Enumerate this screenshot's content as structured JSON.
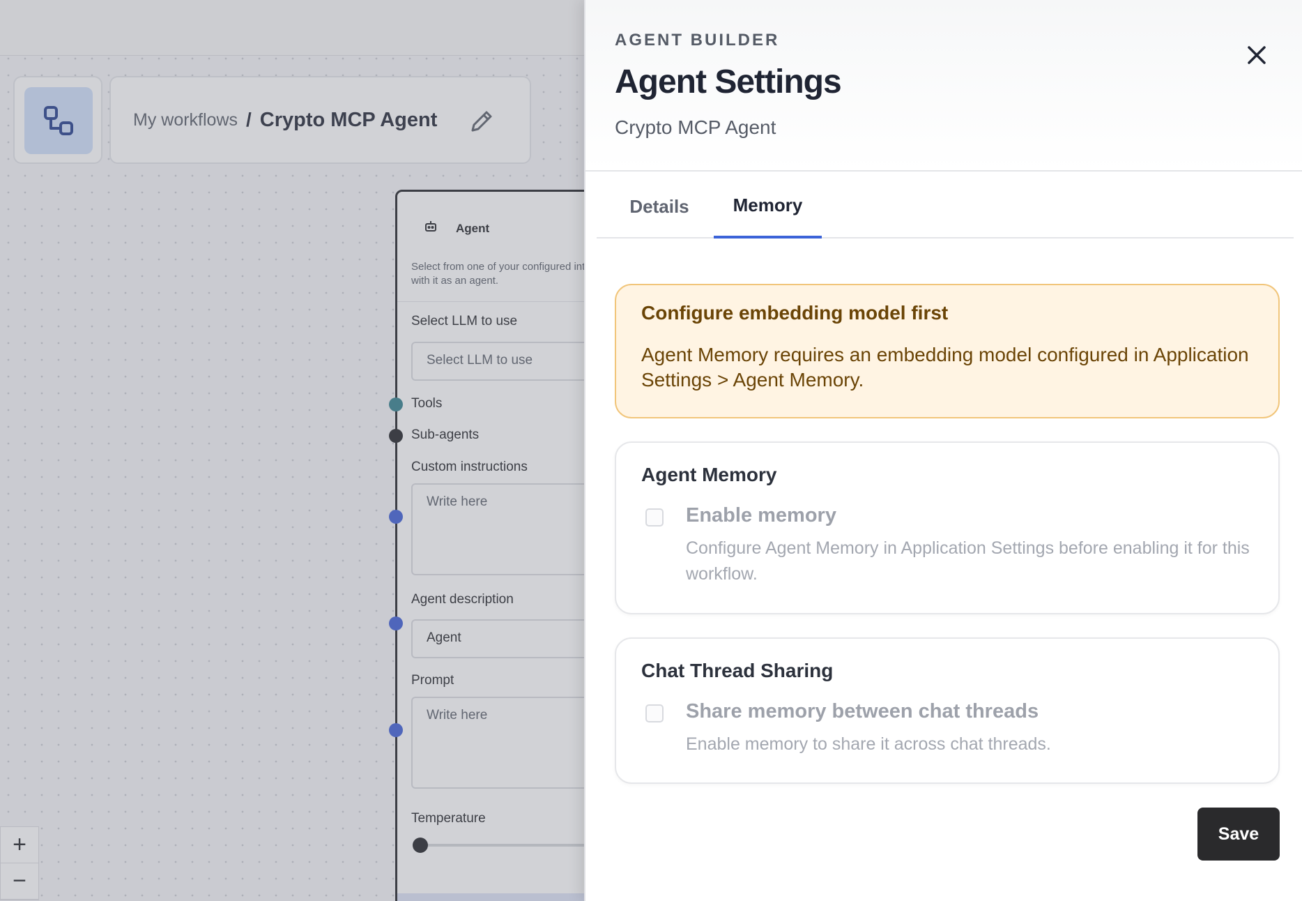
{
  "breadcrumb": {
    "parent": "My workflows",
    "separator": "/",
    "current": "Crypto MCP Agent"
  },
  "node": {
    "title": "Agent",
    "description": "Select from one of your configured interact with it as an agent.",
    "llm_label": "Select LLM to use",
    "llm_placeholder": "Select LLM to use",
    "tools_label": "Tools",
    "subagents_label": "Sub-agents",
    "instructions_label": "Custom instructions",
    "instructions_placeholder": "Write here",
    "description_label": "Agent description",
    "description_value": "Agent",
    "prompt_label": "Prompt",
    "prompt_placeholder": "Write here",
    "temperature_label": "Temperature",
    "handle_colors": {
      "tools": "#2f7f8c",
      "subagents": "#1d1f24",
      "inputs": "#3b5bd6"
    }
  },
  "zoom": {
    "in": "+",
    "out": "−"
  },
  "panel": {
    "eyebrow": "AGENT BUILDER",
    "title": "Agent Settings",
    "subtitle": "Crypto MCP Agent",
    "tabs": [
      {
        "label": "Details",
        "active": false
      },
      {
        "label": "Memory",
        "active": true
      }
    ],
    "alert": {
      "title": "Configure embedding model first",
      "body": "Agent Memory requires an embedding model configured in Application Settings > Agent Memory."
    },
    "memory_card": {
      "title": "Agent Memory",
      "option_label": "Enable memory",
      "option_help": "Configure Agent Memory in Application Settings before enabling it for this workflow.",
      "checked": false
    },
    "sharing_card": {
      "title": "Chat Thread Sharing",
      "option_label": "Share memory between chat threads",
      "option_help": "Enable memory to share it across chat threads.",
      "checked": false
    },
    "save_label": "Save"
  },
  "colors": {
    "accent": "#3b63d8",
    "alert_bg": "#fff4e3",
    "alert_border": "#f1c57a",
    "alert_text": "#6a4406",
    "primary_button": "#2a2a2c"
  }
}
